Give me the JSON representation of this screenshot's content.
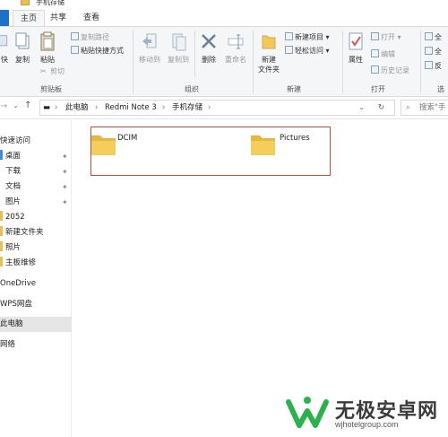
{
  "window": {
    "title": "手机存储"
  },
  "tabs": [
    {
      "label": "主页"
    },
    {
      "label": "共享"
    },
    {
      "label": "查看"
    }
  ],
  "ribbon": {
    "clipboard": {
      "label": "剪贴板",
      "pin_quick_access": "快",
      "copy": "复制",
      "paste": "粘贴",
      "copy_path": "复制路径",
      "paste_shortcut": "粘贴快捷方式",
      "cut": "剪切"
    },
    "organize": {
      "label": "组织",
      "move_to": "移动到",
      "copy_to": "复制到",
      "delete": "删除",
      "rename": "重命名"
    },
    "new": {
      "label": "新建",
      "new_folder": "新建\n文件夹",
      "new_item": "新建项目",
      "easy_access": "轻松访问"
    },
    "open": {
      "label": "打开",
      "properties": "属性",
      "open": "打开",
      "edit": "编辑",
      "history": "历史记录"
    },
    "select": {
      "label": "选",
      "select_all": "全",
      "select_none": "全",
      "invert": "反"
    }
  },
  "address": {
    "crumbs": [
      "此电脑",
      "Redmi Note 3",
      "手机存储"
    ],
    "search_placeholder": "搜索\"手"
  },
  "nav": {
    "items": [
      {
        "label": "快速访问",
        "pinned": false,
        "folder": false
      },
      {
        "label": "桌面",
        "pinned": true,
        "folder": true
      },
      {
        "label": "下载",
        "pinned": true,
        "folder": false
      },
      {
        "label": "文档",
        "pinned": true,
        "folder": false
      },
      {
        "label": "图片",
        "pinned": true,
        "folder": false
      },
      {
        "label": "2052",
        "pinned": false,
        "folder": true
      },
      {
        "label": "新建文件夹",
        "pinned": false,
        "folder": true
      },
      {
        "label": "照片",
        "pinned": false,
        "folder": true
      },
      {
        "label": "主板维修",
        "pinned": false,
        "folder": true
      },
      {
        "label": "OneDrive",
        "pinned": false,
        "folder": false
      },
      {
        "label": "WPS网盘",
        "pinned": false,
        "folder": false
      },
      {
        "label": "此电脑",
        "pinned": false,
        "folder": false,
        "selected": true
      },
      {
        "label": "网络",
        "pinned": false,
        "folder": false
      }
    ]
  },
  "content": {
    "folders": [
      {
        "name": "DCIM"
      },
      {
        "name": "Pictures"
      }
    ]
  },
  "watermark": {
    "text": "无极安卓网",
    "url": "wjhotelgroup.com"
  },
  "colors": {
    "ribbon_bg": "#f5f6f7",
    "folder_yellow": "#f0c95a",
    "selection_border": "#cc4d3f",
    "file_tab_blue": "#1a73c9",
    "logo_green": "#2bb24c"
  }
}
